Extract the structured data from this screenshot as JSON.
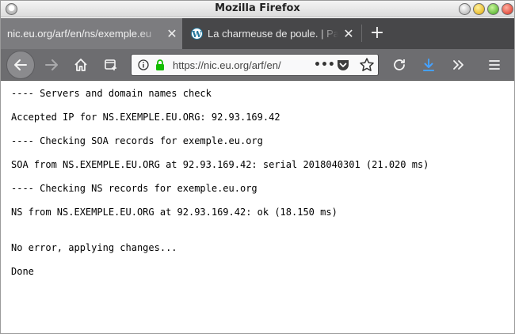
{
  "window": {
    "title": "Mozilla Firefox"
  },
  "tabs": [
    {
      "label": "nic.eu.org/arf/en/ns/exemple.eu",
      "close": "✕",
      "active": true
    },
    {
      "label": "La charmeuse de poule. | Pa",
      "close": "✕",
      "active": false,
      "icon": "wordpress-icon"
    }
  ],
  "new_tab_label": "+",
  "navbar": {
    "url": "https://nic.eu.org/arf/en/",
    "icons": [
      "back-arrow-icon",
      "forward-arrow-icon",
      "home-icon",
      "new-container-tab-icon",
      "info-icon",
      "lock-icon",
      "page-actions-icon",
      "pocket-icon",
      "bookmark-star-icon",
      "reload-icon",
      "download-icon",
      "overflow-icon",
      "hamburger-menu-icon"
    ],
    "colors": {
      "secure_lock": "#12bc00",
      "download": "#45a1ff"
    }
  },
  "content": {
    "lines": [
      "---- Servers and domain names check",
      "Accepted IP for NS.EXEMPLE.EU.ORG: 92.93.169.42",
      "---- Checking SOA records for exemple.eu.org",
      "SOA from NS.EXEMPLE.EU.ORG at 92.93.169.42: serial 2018040301 (21.020 ms)",
      "---- Checking NS records for exemple.eu.org",
      "NS from NS.EXEMPLE.EU.ORG at 92.93.169.42: ok (18.150 ms)",
      "No error, applying changes...",
      "Done"
    ]
  }
}
